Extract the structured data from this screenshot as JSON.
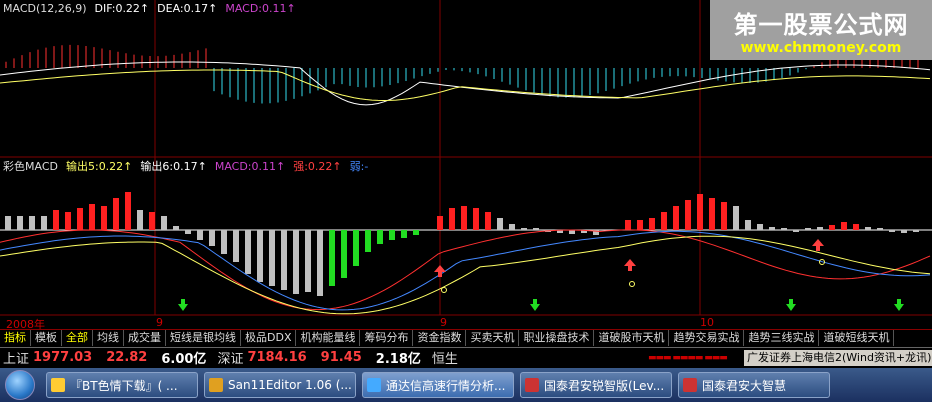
{
  "watermark": {
    "title": "第一股票公式网",
    "url": "www.chnmoney.com"
  },
  "panel1": {
    "legend": [
      {
        "text": "MACD(12,26,9)",
        "color": "#dddddd"
      },
      {
        "text": "DIF:0.22↑",
        "color": "#ffffff"
      },
      {
        "text": "DEA:0.17↑",
        "color": "#ffffff"
      },
      {
        "text": "MACD:0.11↑",
        "color": "#cc44cc"
      }
    ]
  },
  "panel2": {
    "legend": [
      {
        "text": "彩色MACD",
        "color": "#dddddd"
      },
      {
        "text": "输出5:0.22↑",
        "color": "#ffff66"
      },
      {
        "text": "输出6:0.17↑",
        "color": "#ffffff"
      },
      {
        "text": "MACD:0.11↑",
        "color": "#cc44cc"
      },
      {
        "text": "强:0.22↑",
        "color": "#ff4040"
      },
      {
        "text": "弱:-",
        "color": "#4488ff"
      }
    ]
  },
  "date_labels": {
    "year": "2008年",
    "m9": "9",
    "m10": "10"
  },
  "tabs": [
    "指标",
    "模板",
    "全部",
    "均线",
    "成交量",
    "短线是银均线",
    "极品DDX",
    "机构能量线",
    "筹码分布",
    "资金指数",
    "买卖天机",
    "职业操盘技术",
    "道破股市天机",
    "趋势交易实战",
    "趋势三线实战",
    "道破短线天机"
  ],
  "quotes": {
    "sh_name": "上证",
    "sh_index": "1977.03",
    "sh_change": "22.82",
    "sh_amount": "6.00亿",
    "sz_name": "深证",
    "sz_index": "7184.16",
    "sz_change": "91.45",
    "sz_amount": "2.18亿",
    "hs_name": "恒生",
    "ticker": "广发证券上海电信2(Wind资讯+龙讯)"
  },
  "taskbar": {
    "items": [
      {
        "label": "『BT色情下载』( ...",
        "icon_color": "#ffcc33"
      },
      {
        "label": "San11Editor 1.06 (...",
        "icon_color": "#e0a020"
      },
      {
        "label": "通达信高速行情分析...",
        "icon_color": "#44aaff"
      },
      {
        "label": "国泰君安锐智版(Lev...",
        "icon_color": "#cc3333"
      },
      {
        "label": "国泰君安大智慧",
        "icon_color": "#cc3333"
      }
    ]
  },
  "colors": {
    "up_red": "#ff2020",
    "down_green": "#22dd22",
    "neutral_gray": "#c0c0c0",
    "grid_red": "#800000"
  }
}
